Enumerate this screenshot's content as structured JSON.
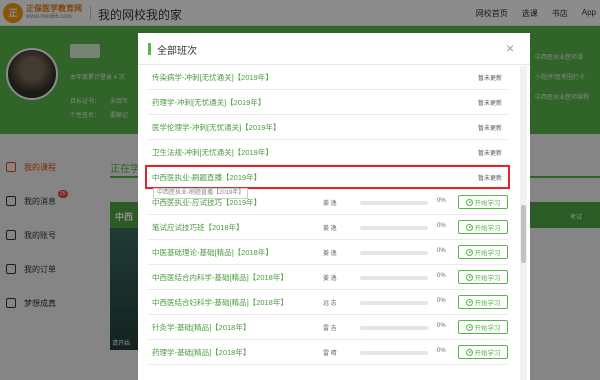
{
  "header": {
    "brand": "正保医学教育网",
    "brand_url": "www.med66.com",
    "site_title": "我的网校我的家",
    "nav": [
      "网校首页",
      "选课",
      "书店",
      "App"
    ]
  },
  "banner": {
    "line1": "本年度累计登录 4 次",
    "label_cert": "目标证书：",
    "value_cert": "未填写",
    "label_sign": "个性签名：",
    "value_sign": "要输记",
    "right1": "中西医执业医师课",
    "right2": "小程序“医考圈打卡",
    "right3": "中西医执业医师课程"
  },
  "sidebar": {
    "items": [
      {
        "label": "我的课程"
      },
      {
        "label": "我的消息",
        "badge": "25"
      },
      {
        "label": "我的账号"
      },
      {
        "label": "我的订单"
      },
      {
        "label": "梦想成真"
      }
    ]
  },
  "content": {
    "tab": "正在学",
    "card_title": "中西",
    "card_right": "考试",
    "card_img_text": "请开始"
  },
  "modal": {
    "title": "全部班次",
    "close": "×",
    "start_label": "开始学习",
    "rows": [
      {
        "name": "传染病学-冲刺[无忧通关]【2019年】",
        "status": "暂未更新"
      },
      {
        "name": "药理学-冲刺[无忧通关]【2019年】",
        "status": "暂未更新"
      },
      {
        "name": "医学伦理学-冲刺[无忧通关]【2019年】",
        "status": "暂未更新"
      },
      {
        "name": "卫生法规-冲刺[无忧通关]【2019年】",
        "status": "暂未更新"
      },
      {
        "name": "中西医执业-刷题直播【2019年】",
        "status": "暂未更新"
      },
      {
        "name": "中西医执业-应试技巧【2019年】",
        "teacher": "姜 逸",
        "progress": "0%"
      },
      {
        "name": "笔试应试技巧班【2018年】",
        "teacher": "姜 逸",
        "progress": "0%"
      },
      {
        "name": "中医基础理论-基础[精品]【2018年】",
        "teacher": "姜 逸",
        "progress": "0%"
      },
      {
        "name": "中西医结合内科学-基础[精品]【2018年】",
        "teacher": "姜 逸",
        "progress": "0%"
      },
      {
        "name": "中西医结合妇科学-基础[精品]【2018年】",
        "teacher": "远 志",
        "progress": "0%"
      },
      {
        "name": "针灸学-基础[精品]【2018年】",
        "teacher": "雷 吉",
        "progress": "0%"
      },
      {
        "name": "药理学-基础[精品]【2018年】",
        "teacher": "雷 晴",
        "progress": "0%"
      }
    ],
    "tooltip": "中西医执业-刷题直播【2019年】"
  },
  "colors": {
    "accent": "#58b64a",
    "highlight": "#e0262e",
    "link": "#4a9a3e"
  }
}
